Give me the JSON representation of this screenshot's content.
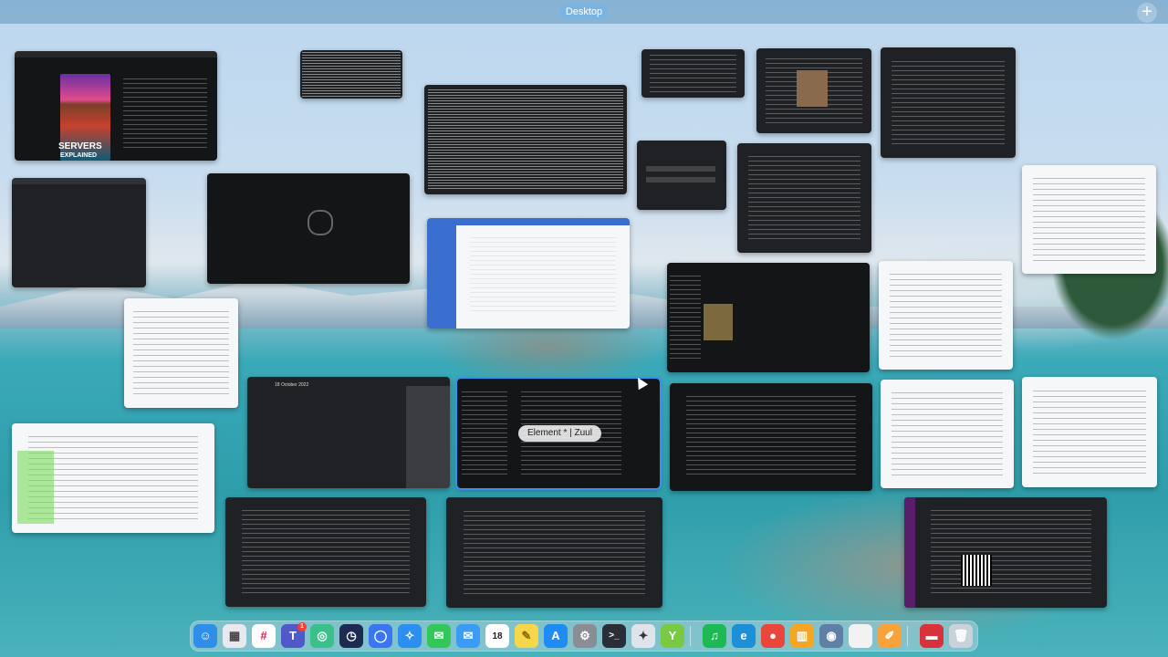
{
  "topbar": {
    "space_label": "Desktop",
    "add_space_icon": "plus-icon",
    "add_space_glyph": "+"
  },
  "windows": {
    "youtube": {
      "thumb_title": "SERVERS",
      "thumb_subtitle": "EXPLAINED"
    },
    "calendar": {
      "date_title": "18 October 2022"
    },
    "element": {
      "label": "Element * | Zuul"
    }
  },
  "dock": {
    "items": [
      {
        "name": "finder",
        "glyph": "☺",
        "color": "#2f8fe8"
      },
      {
        "name": "launchpad",
        "glyph": "▦",
        "color": "#e8e8ee"
      },
      {
        "name": "slack",
        "glyph": "#",
        "color": "#fdfdfd"
      },
      {
        "name": "teams",
        "glyph": "T",
        "color": "#5158c8",
        "badge": "1"
      },
      {
        "name": "chatgpt",
        "glyph": "◎",
        "color": "#3cc08a"
      },
      {
        "name": "clock",
        "glyph": "◷",
        "color": "#1d2a52"
      },
      {
        "name": "signal",
        "glyph": "◯",
        "color": "#3a76f0"
      },
      {
        "name": "safari",
        "glyph": "✧",
        "color": "#2b8ff0"
      },
      {
        "name": "messages",
        "glyph": "✉",
        "color": "#33c759"
      },
      {
        "name": "mail",
        "glyph": "✉",
        "color": "#3b9cf5"
      },
      {
        "name": "calendar",
        "glyph": "18",
        "color": "#ffffff"
      },
      {
        "name": "notes",
        "glyph": "✎",
        "color": "#f6d74a"
      },
      {
        "name": "app-store",
        "glyph": "A",
        "color": "#1f8cf5"
      },
      {
        "name": "system-settings",
        "glyph": "⚙",
        "color": "#8a8d93"
      },
      {
        "name": "terminal",
        "glyph": ">_",
        "color": "#2a2e36"
      },
      {
        "name": "unreal",
        "glyph": "✦",
        "color": "#dfe4ea"
      },
      {
        "name": "yoink",
        "glyph": "Y",
        "color": "#7ac943"
      },
      {
        "name": "spotify",
        "glyph": "♫",
        "color": "#1db954"
      },
      {
        "name": "edge",
        "glyph": "e",
        "color": "#1c8fd6"
      },
      {
        "name": "chrome",
        "glyph": "●",
        "color": "#e9473b"
      },
      {
        "name": "books",
        "glyph": "▥",
        "color": "#f5a623"
      },
      {
        "name": "automator",
        "glyph": "◉",
        "color": "#5f7fa6"
      },
      {
        "name": "blank-app",
        "glyph": "",
        "color": "#f2f2f2"
      },
      {
        "name": "pages",
        "glyph": "✐",
        "color": "#f7a33a"
      },
      {
        "name": "folder",
        "glyph": "▬",
        "color": "#d8323a"
      },
      {
        "name": "trash",
        "glyph": "🗑",
        "color": "#c9d2d8"
      }
    ]
  }
}
